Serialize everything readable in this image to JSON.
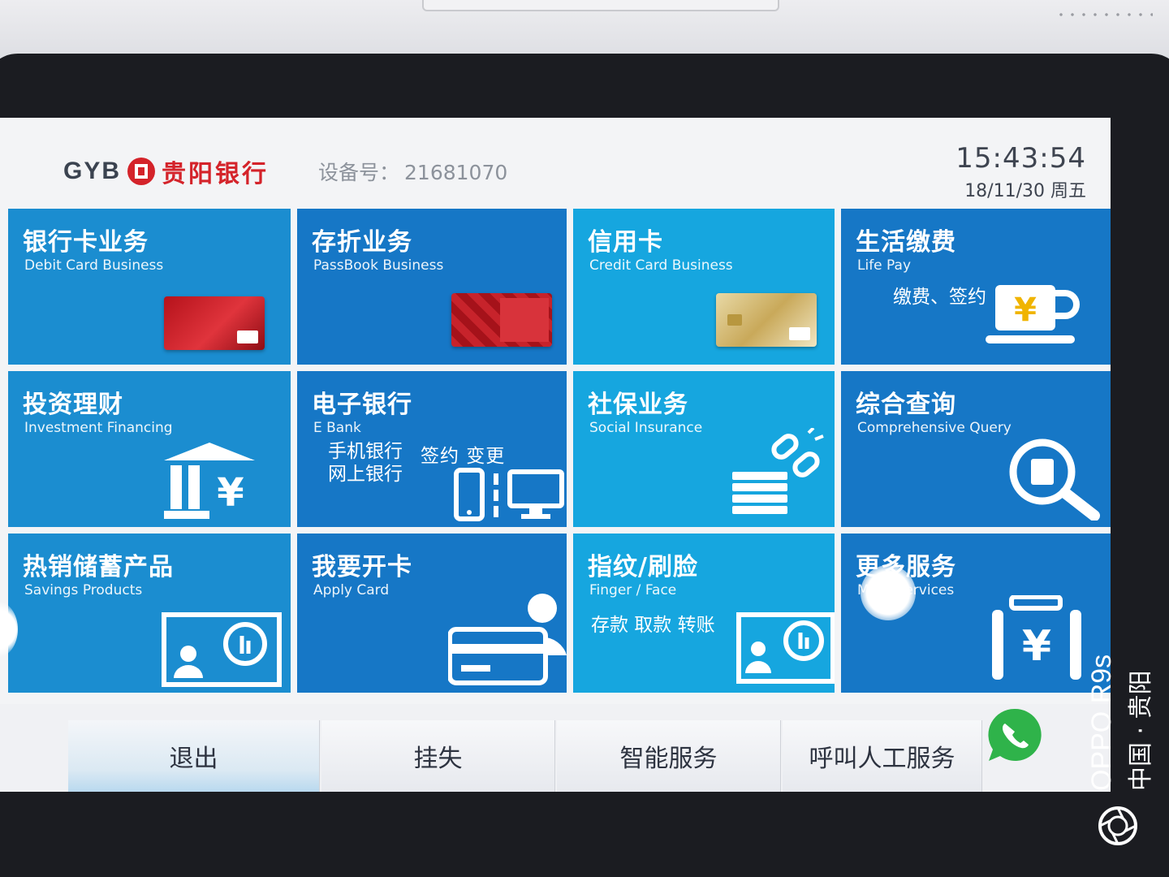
{
  "header": {
    "bank_logo_text": "GYB",
    "bank_name": "贵阳银行",
    "device_label": "设备号：",
    "device_number": "21681070",
    "time": "15:43:54",
    "date": "18/11/30 周五"
  },
  "tiles": {
    "debit_card": {
      "title": "银行卡业务",
      "subtitle": "Debit Card Business"
    },
    "passbook": {
      "title": "存折业务",
      "subtitle": "PassBook Business"
    },
    "credit_card": {
      "title": "信用卡",
      "subtitle": "Credit Card Business"
    },
    "life_pay": {
      "title": "生活缴费",
      "subtitle": "Life Pay",
      "extra": "缴费、签约"
    },
    "investment": {
      "title": "投资理财",
      "subtitle": "Investment Financing"
    },
    "ebank": {
      "title": "电子银行",
      "subtitle": "E Bank",
      "line1": "手机银行",
      "line2": "网上银行",
      "actions": "签约 变更"
    },
    "social_insurance": {
      "title": "社保业务",
      "subtitle": "Social Insurance"
    },
    "query": {
      "title": "综合查询",
      "subtitle": "Comprehensive Query"
    },
    "savings": {
      "title": "热销储蓄产品",
      "subtitle": "Savings Products"
    },
    "apply_card": {
      "title": "我要开卡",
      "subtitle": "Apply Card"
    },
    "finger_face": {
      "title": "指纹/刷脸",
      "subtitle": "Finger / Face",
      "extra": "存款 取款 转账"
    },
    "more": {
      "title": "更多服务",
      "subtitle": "More Services"
    }
  },
  "bottom_bar": {
    "exit": "退出",
    "report_loss": "挂失",
    "smart_service": "智能服务",
    "call_staff": "呼叫人工服务"
  },
  "watermark": {
    "model": "OPPO R9s",
    "location": "中国 · 贵阳"
  },
  "colors": {
    "tile_blue": "#1b8dd0",
    "tile_dark": "#1677c6",
    "tile_cyan": "#16a6df",
    "brand_red": "#d4232a",
    "phone_green": "#2fb34a"
  }
}
